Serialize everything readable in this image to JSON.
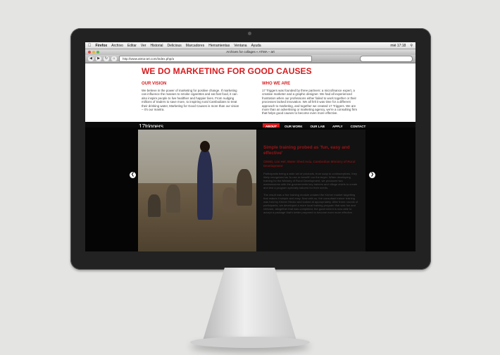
{
  "menubar": {
    "apple_icon": "apple-icon",
    "items": [
      "Firefox",
      "Archivo",
      "Editar",
      "Ver",
      "Historial",
      "Delicious",
      "Marcadores",
      "Herramientas",
      "Ventana",
      "Ayuda"
    ],
    "clock": "mié 17:18"
  },
  "window": {
    "title": "Archives for collages « ATMA – art",
    "url": "http://www.atma-art.com/index.php/a",
    "search_placeholder": ""
  },
  "page": {
    "headline": "WE DO MARKETING FOR GOOD CAUSES",
    "vision_title": "OUR VISION",
    "vision_text": "We believe in the power of marketing for positive change. If marketing can influence the masses to smoke cigarettes and eat fast food, it can also inspire people to live healthier and happier lives. From nudging millions of traders to save more, to inspiring rural Cambodians to treat their drinking water, Marketing for Good Causes is more than our vision – it's our mantra.",
    "who_title": "WHO WE ARE",
    "who_text": "17 Triggers was founded by three partners: a microfinance expert, a creative marketer and a graphic designer. We had all experienced frustration when our professions either failed to work together or their processes lacked innovation. We all felt it was time for a different approach to marketing, and together we created 17 Triggers. We are more than an advertising or marketing agency, we're a consulting firm that helps good causes to become even more effective.",
    "logo": "17triggers",
    "nav": [
      "ABOUT",
      "OUR WORK",
      "OUR LAB",
      "APPLY",
      "CONTACT"
    ],
    "slide_title": "Simple training probed as 'fun, easy and effective'",
    "slide_sub": "CEMO, Lim Hel, Water Shed Asia, Cambodian Ministry of Rural Development",
    "slide_p1": "Participants being a wide set of products, from soap to contraceptives, they likely recognized as 'to use or benefit' our the buyer. When developing training for the Ministry of Rural Development, we produced two worksessions with the governments key trainers and village chiefs to create and test a program specially tailored for their needs.",
    "slide_p2": "The result was a five training module created the Khmer market targetting that makes it simple and easy. Now with us, the consultant trainer training was held by Khmer Hiroko and looked at appropriately. After three rounds of participants, we developed a more local training program that was fun and relevant, altogether that was completed, the government is now able to accept a package that's better prepared to become even more effective."
  }
}
